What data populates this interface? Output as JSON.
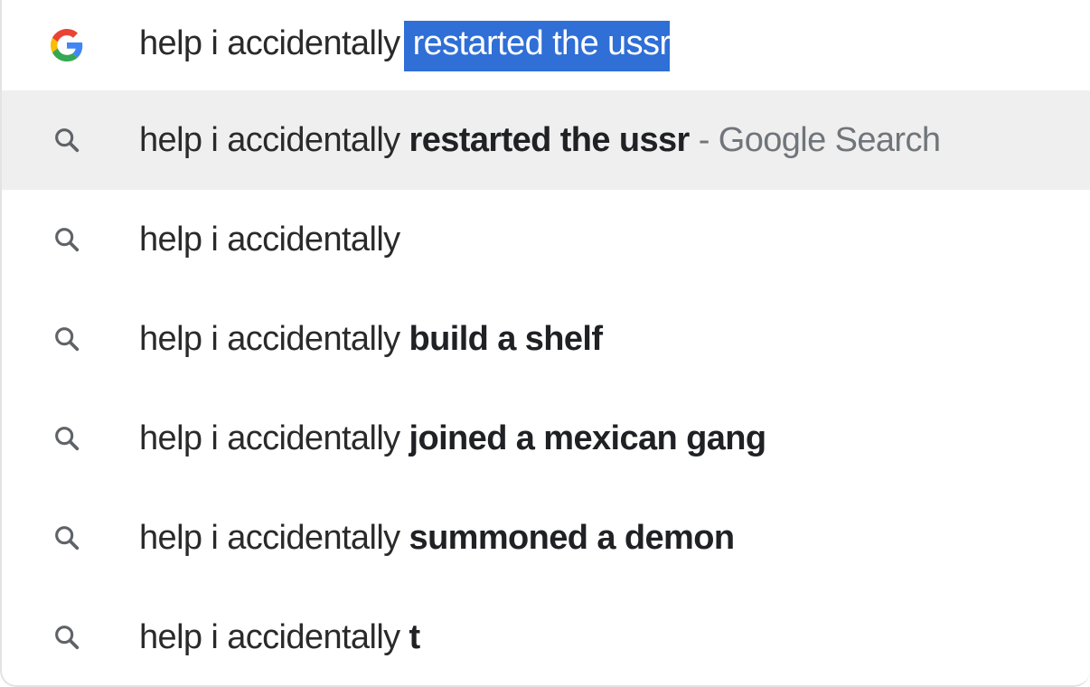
{
  "omnibox": {
    "typed_text": "help i accidentally",
    "autocomplete_text": "restarted the ussr",
    "icon": "google-g-icon",
    "google_colors": {
      "blue": "#4285F4",
      "red": "#EA4335",
      "yellow": "#FBBC05",
      "green": "#34A853"
    }
  },
  "suggestions": [
    {
      "prefix": "help i accidentally",
      "bold": "restarted the ussr",
      "suffix": "- Google Search",
      "icon": "search-icon",
      "selected": true
    },
    {
      "prefix": "help i accidentally",
      "bold": "",
      "suffix": "",
      "icon": "search-icon",
      "selected": false
    },
    {
      "prefix": "help i accidentally",
      "bold": "build a shelf",
      "suffix": "",
      "icon": "search-icon",
      "selected": false
    },
    {
      "prefix": "help i accidentally",
      "bold": "joined a mexican gang",
      "suffix": "",
      "icon": "search-icon",
      "selected": false
    },
    {
      "prefix": "help i accidentally",
      "bold": "summoned a demon",
      "suffix": "",
      "icon": "search-icon",
      "selected": false
    },
    {
      "prefix": "help i accidentally",
      "bold": "t",
      "suffix": "",
      "icon": "search-icon",
      "selected": false
    }
  ],
  "colors": {
    "selection_highlight": "#2F6FD6",
    "selected_row_bg": "#EFEFEF",
    "suffix_text": "#70757A"
  }
}
